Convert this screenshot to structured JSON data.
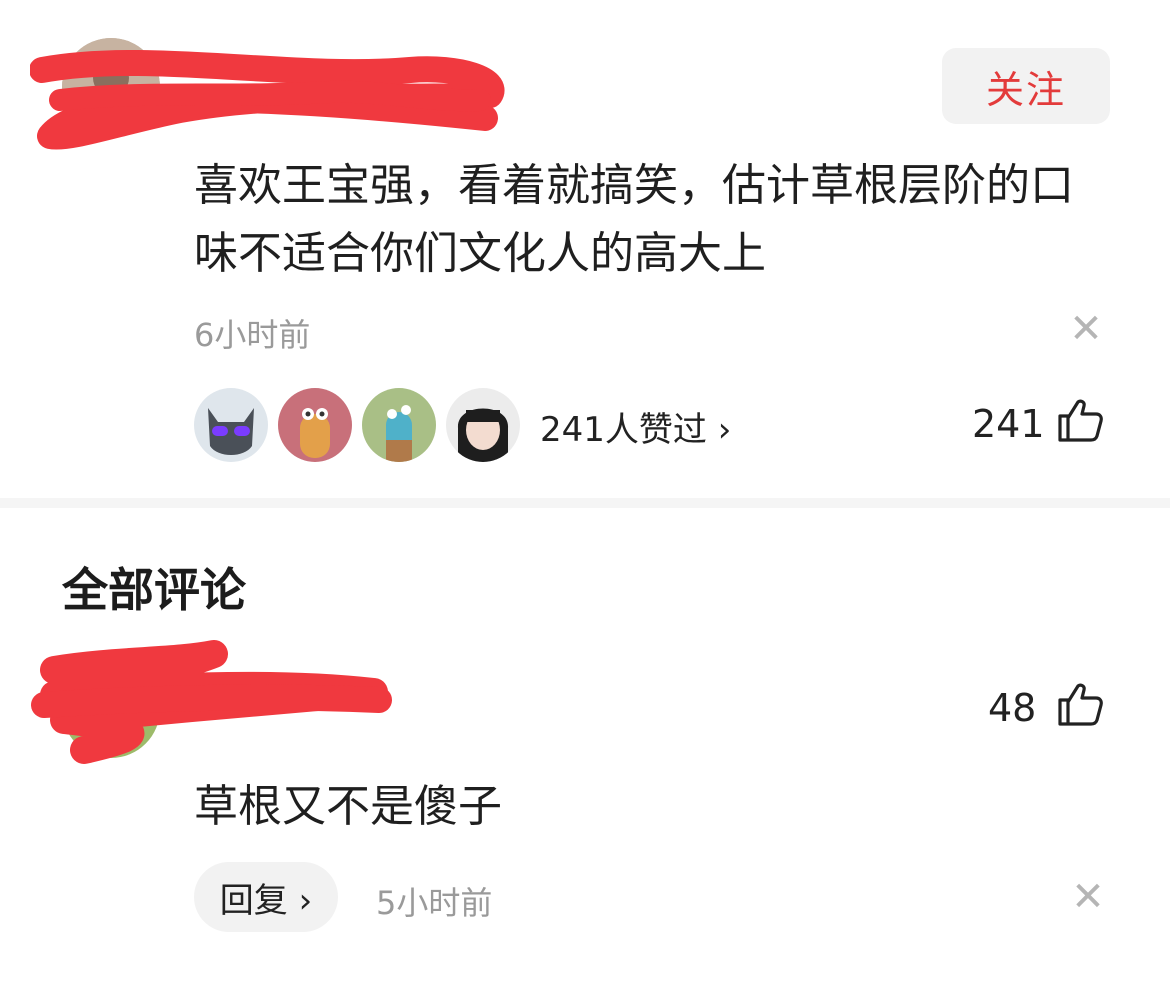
{
  "comment": {
    "follow_label": "关注",
    "text": "喜欢王宝强，看着就搞笑，估计草根层阶的口味不适合你们文化人的高大上",
    "time": "6小时前",
    "likers_summary": "241人赞过 ›",
    "like_count": "241"
  },
  "section": {
    "title": "全部评论"
  },
  "reply": {
    "text": "草根又不是傻子",
    "like_count": "48",
    "reply_label": "回复 ›",
    "time": "5小时前"
  },
  "icons": {
    "close": "close-icon",
    "thumb": "thumbs-up-icon"
  },
  "colors": {
    "follow_text": "#e33b3b",
    "redaction": "#f0393f",
    "muted_text": "#9a9a9a"
  }
}
